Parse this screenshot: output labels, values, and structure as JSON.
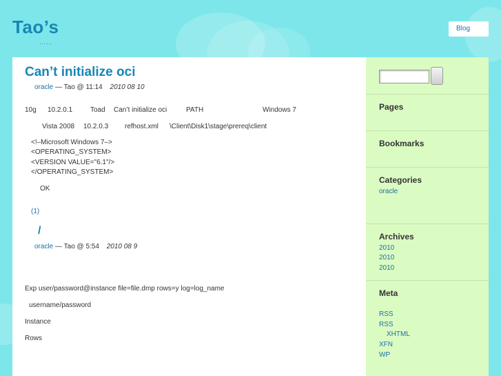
{
  "header": {
    "title": "Tao’s",
    "tagline": "……",
    "nav": {
      "blog_label": "Blog"
    }
  },
  "posts": [
    {
      "title": "Can’t initialize oci",
      "category": "oracle",
      "author_time": "— Tao @ 11:14",
      "date": "2010  08  10",
      "lines": {
        "l1a": "10g",
        "l1b": "10.2.0.1",
        "l1c": "Toad",
        "l1d": "Can’t initialize oci",
        "l1e": "PATH",
        "l1f": "Windows 7",
        "l2a": "Vista 2008",
        "l2b": "10.2.0.3",
        "l2c": "refhost.xml",
        "l2d": "\\Client\\Disk1\\stage\\prereq\\client",
        "code1": "<!–Microsoft Windows 7–>",
        "code2": "<OPERATING_SYSTEM>",
        "code3": "<VERSION VALUE=\"6.1\"/>",
        "code4": "</OPERATING_SYSTEM>",
        "ok": "OK"
      },
      "comments": "(1)"
    },
    {
      "title": "/",
      "category": "oracle",
      "author_time": "— Tao @ 5:54",
      "date": "2010  08  9",
      "lines": {
        "exp": "Exp user/password@instance file=file.dmp rows=y log=log_name",
        "up": "username/password",
        "inst": "Instance",
        "rows": "Rows"
      }
    }
  ],
  "sidebar": {
    "pages": {
      "heading": "Pages"
    },
    "bookmarks": {
      "heading": "Bookmarks"
    },
    "categories": {
      "heading": "Categories",
      "items": [
        "oracle"
      ]
    },
    "archives": {
      "heading": "Archives",
      "items": [
        "2010",
        "2010",
        "2010"
      ]
    },
    "meta": {
      "heading": "Meta",
      "items": [
        "RSS",
        "RSS",
        "XHTML",
        "XFN",
        "WP"
      ]
    }
  }
}
